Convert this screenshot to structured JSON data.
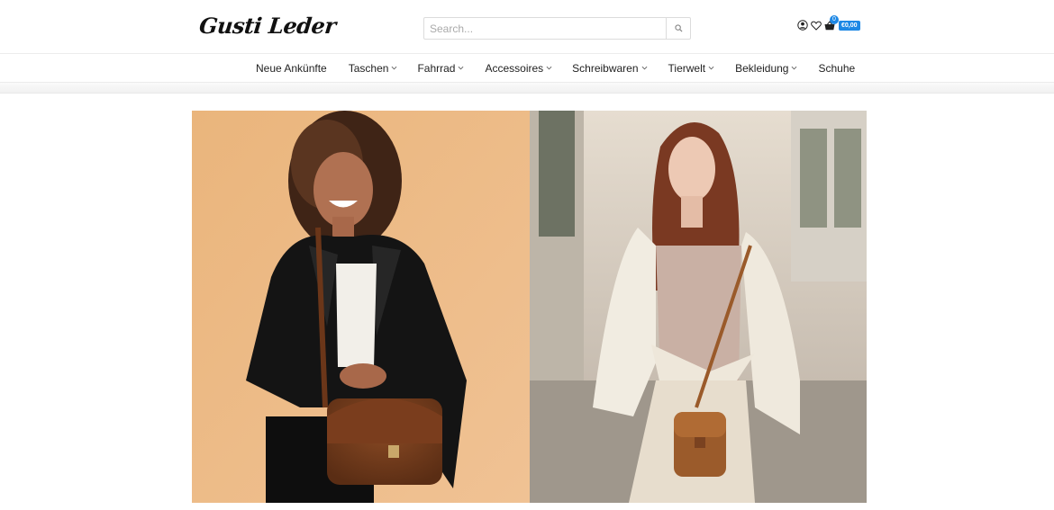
{
  "header": {
    "logo_text": "Gusti Leder",
    "search_placeholder": "Search...",
    "cart_count": "0",
    "cart_total": "€0,00"
  },
  "nav": {
    "items": [
      {
        "label": "Neue Ankünfte",
        "has_dropdown": false
      },
      {
        "label": "Taschen",
        "has_dropdown": true
      },
      {
        "label": "Fahrrad",
        "has_dropdown": true
      },
      {
        "label": "Accessoires",
        "has_dropdown": true
      },
      {
        "label": "Schreibwaren",
        "has_dropdown": true
      },
      {
        "label": "Tierwelt",
        "has_dropdown": true
      },
      {
        "label": "Bekleidung",
        "has_dropdown": true
      },
      {
        "label": "Schuhe",
        "has_dropdown": false
      }
    ]
  },
  "icons": {
    "account": "user-circle-icon",
    "wishlist": "heart-icon",
    "cart": "shopping-basket-icon",
    "search": "magnifier-icon"
  },
  "colors": {
    "accent": "#1e88e5",
    "left_panel_bg": "#e9b27a",
    "right_panel_bg": "#d9cfc3"
  }
}
